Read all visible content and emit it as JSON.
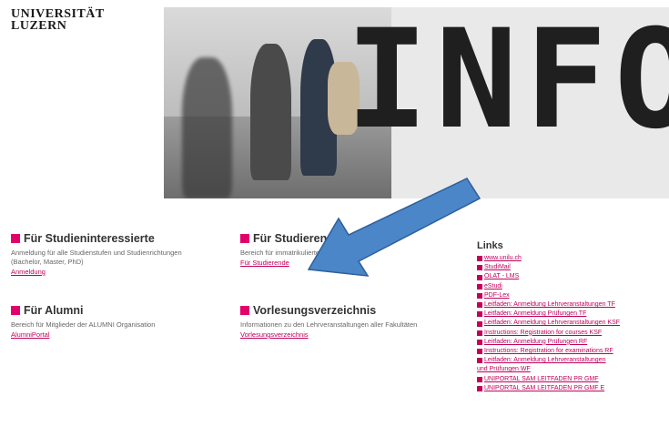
{
  "logo": {
    "line1": "UNIVERSITÄT",
    "line2": "LUZERN"
  },
  "hero": {
    "text": "INFO"
  },
  "sections": {
    "interessierte": {
      "title": "Für Studieninteressierte",
      "text": "Anmeldung für alle Studienstufen und Studienrichtungen (Bachelor, Master, PhD)",
      "link": "Anmeldung"
    },
    "alumni": {
      "title": "Für Alumni",
      "text": "Bereich für Mitglieder der ALUMNI Organisation",
      "link": "AlumniPortal"
    },
    "studierende": {
      "title": "Für Studierende",
      "text": "Bereich für immatrikulierte Studierende",
      "link": "Für Studierende"
    },
    "vorlesung": {
      "title": "Vorlesungsverzeichnis",
      "text": "Informationen zu den Lehrveranstaltungen aller Fakultäten",
      "link": "Vorlesungsverzeichnis"
    }
  },
  "links": {
    "title": "Links",
    "items": [
      "www.unilu.ch",
      "StudiMail",
      "OLAT - LMS",
      "eStudi",
      "PDF-Lex",
      "Leitfaden: Anmeldung Lehrveranstaltungen TF",
      "Leitfaden: Anmeldung Prüfungen TF",
      "Leitfaden: Anmeldung Lehrveranstaltungen KSF",
      "Instructions: Registration for courses KSF",
      "Leitfaden: Anmeldung Prüfungen RF",
      "Instructions: Registration for examinations RF",
      "Leitfaden: Anmeldung Lehrveranstaltungen",
      "und Prüfungen WF",
      "UNIPORTAL SAM LEITFADEN PR GMF",
      "UNIPORTAL SAM LEITFADEN PR GMF E"
    ]
  },
  "colors": {
    "accent": "#e2006b",
    "arrow": "#4a86c8"
  }
}
